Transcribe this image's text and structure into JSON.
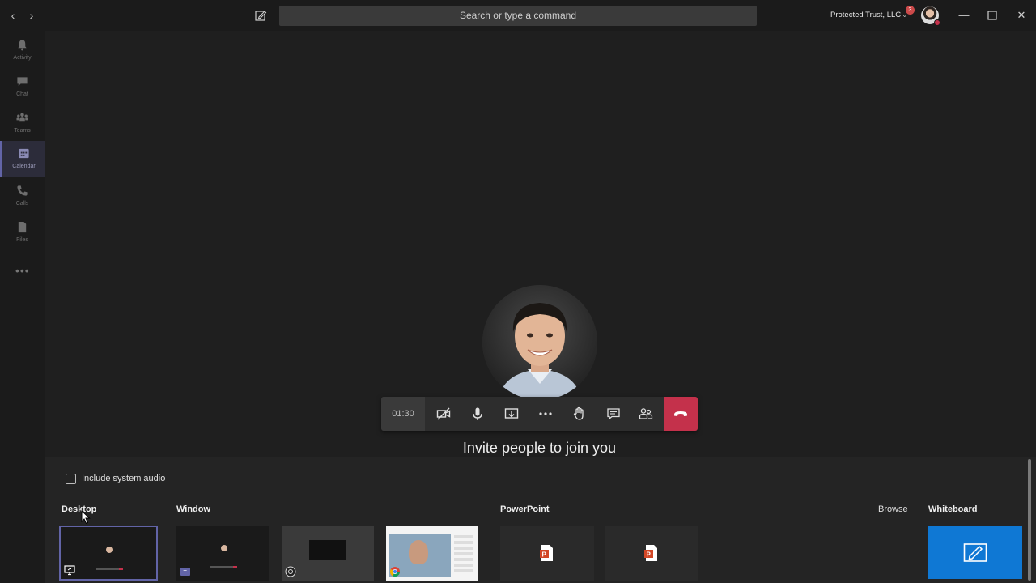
{
  "titlebar": {
    "search_placeholder": "Search or type a command",
    "org_name": "Protected Trust, LLC",
    "notification_count": "3"
  },
  "rail": {
    "items": [
      {
        "label": "Activity",
        "icon": "bell-icon"
      },
      {
        "label": "Chat",
        "icon": "chat-icon"
      },
      {
        "label": "Teams",
        "icon": "teams-icon"
      },
      {
        "label": "Calendar",
        "icon": "calendar-icon",
        "active": true
      },
      {
        "label": "Calls",
        "icon": "phone-icon"
      },
      {
        "label": "Files",
        "icon": "file-icon"
      }
    ],
    "more": "•••"
  },
  "call": {
    "duration": "01:30",
    "invite_text": "Invite people to join you",
    "hangup_color": "#c4314b"
  },
  "share_tray": {
    "include_audio_label": "Include system audio",
    "include_audio_checked": false,
    "sections": {
      "desktop": "Desktop",
      "window": "Window",
      "powerpoint": "PowerPoint",
      "browse": "Browse",
      "whiteboard": "Whiteboard"
    }
  },
  "colors": {
    "accent": "#6264a7",
    "whiteboard": "#0f78d4",
    "background": "#1f1f1f"
  }
}
